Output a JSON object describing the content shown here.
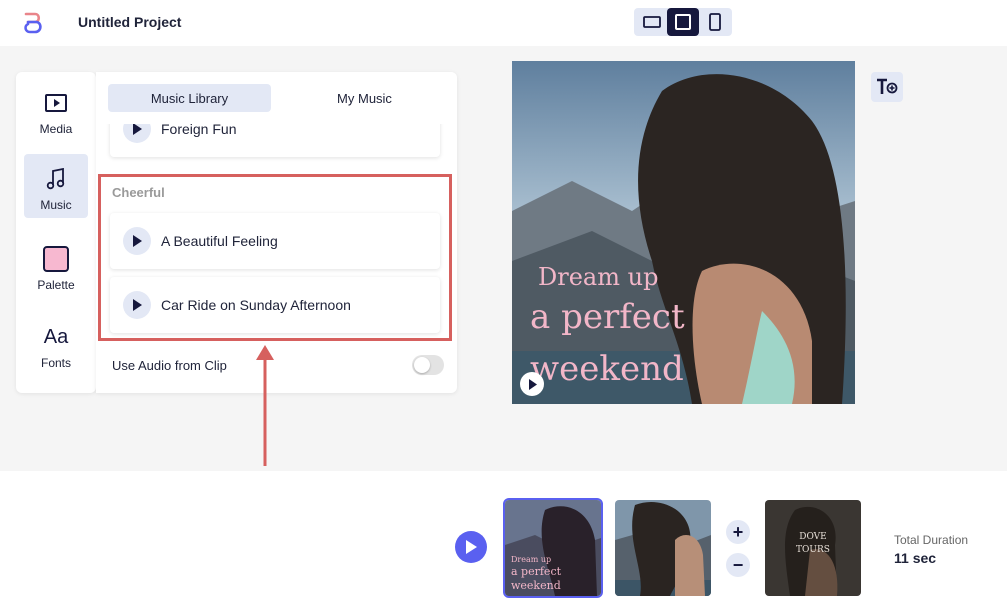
{
  "header": {
    "title": "Untitled Project",
    "aspect_ratios": [
      "landscape",
      "square",
      "portrait"
    ],
    "active_aspect": "square"
  },
  "sidebar": {
    "items": [
      {
        "label": "Media",
        "icon": "play-square-icon"
      },
      {
        "label": "Music",
        "icon": "music-note-icon",
        "active": true
      },
      {
        "label": "Palette",
        "icon": "palette-swatch-icon",
        "swatch_color": "#f7b8d0"
      },
      {
        "label": "Fonts",
        "icon": "fonts-aa-icon",
        "glyph": "Aa"
      }
    ]
  },
  "music_panel": {
    "tabs": [
      {
        "label": "Music Library",
        "active": true
      },
      {
        "label": "My Music",
        "active": false
      }
    ],
    "partial_track": "Foreign Fun",
    "category": "Cheerful",
    "tracks": [
      "A Beautiful Feeling",
      "Car Ride on Sunday Afternoon"
    ],
    "audio_from_clip_label": "Use Audio from Clip",
    "audio_from_clip_enabled": false
  },
  "preview": {
    "line1": "Dream up",
    "line2": "a perfect",
    "line3": "weekend",
    "text_tool": "T+"
  },
  "timeline": {
    "clips": [
      {
        "lines": [
          "Dream up",
          "a perfect",
          "weekend"
        ],
        "selected": true
      },
      {
        "lines": [],
        "selected": false
      },
      {
        "lines": [
          "DOVE",
          "TOURS"
        ],
        "selected": false
      }
    ],
    "total_duration_label": "Total Duration",
    "total_duration_value": "11 sec"
  },
  "colors": {
    "accent": "#5a60f0",
    "navy": "#16183d",
    "highlight_box": "#d6605e",
    "active_bg": "#e3e8f5",
    "overlay_text": "#f2b6c8"
  }
}
